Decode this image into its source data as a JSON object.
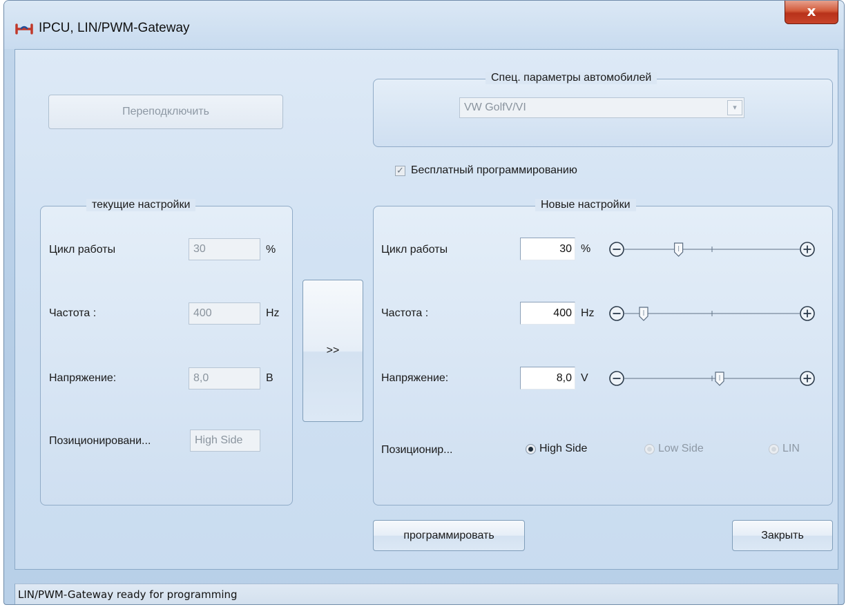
{
  "window": {
    "title": "IPCU, LIN/PWM-Gateway",
    "close_glyph": "x"
  },
  "reconnect_button": "Переподключить",
  "vehicle_group": {
    "title": "Спец. параметры автомобилей",
    "selected_vehicle": "VW GolfV/VI",
    "arrow": "▾"
  },
  "free_programming": {
    "label": "Бесплатный программированию",
    "checked": true,
    "check_glyph": "✓"
  },
  "current_settings": {
    "title": "текущие настройки",
    "duty_cycle": {
      "label": "Цикл работы",
      "value": "30",
      "unit": "%"
    },
    "frequency": {
      "label": "Частота :",
      "value": "400",
      "unit": "Hz"
    },
    "voltage": {
      "label": "Напряжение:",
      "value": "8,0",
      "unit": "B"
    },
    "positioning": {
      "label": "Позиционировани...",
      "value": "High Side"
    }
  },
  "transfer_button": ">>",
  "new_settings": {
    "title": "Новые настройки",
    "duty_cycle": {
      "label": "Цикл работы",
      "value": "30",
      "unit": "%",
      "slider_level": 0.28
    },
    "frequency": {
      "label": "Частота :",
      "value": "400",
      "unit": "Hz",
      "slider_level": 0.05
    },
    "voltage": {
      "label": "Напряжение:",
      "value": "8,0",
      "unit": "V",
      "slider_level": 0.55
    },
    "positioning": {
      "label": "Позиционир...",
      "options": [
        {
          "label": "High Side",
          "selected": true,
          "enabled": true
        },
        {
          "label": "Low Side",
          "selected": false,
          "enabled": false
        },
        {
          "label": "LIN",
          "selected": false,
          "enabled": false
        }
      ]
    }
  },
  "program_button": "программировать",
  "close_button": "Закрыть",
  "status_text": "LIN/PWM-Gateway ready for programming",
  "colors": {
    "accent_icon": "#c0392b",
    "window_border": "#6e8aa8",
    "close_button": "#c8442a"
  }
}
